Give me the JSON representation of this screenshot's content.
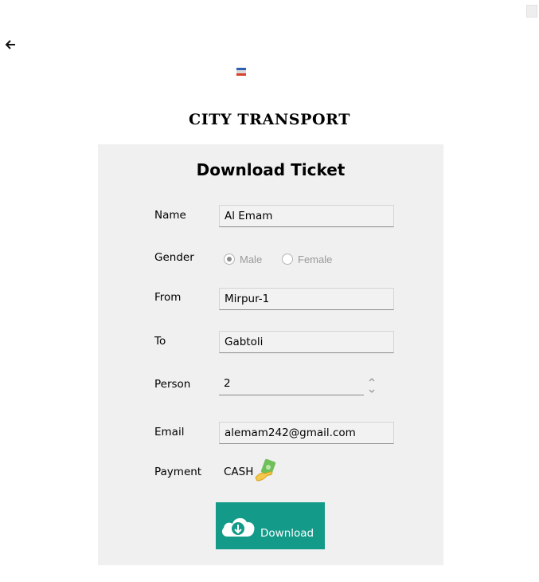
{
  "header": {
    "back_icon": "back-arrow-icon",
    "flag_icon": "flag-icon",
    "app_title": "CITY TRANSPORT"
  },
  "form": {
    "title": "Download Ticket",
    "name_label": "Name",
    "name_value": "Al Emam",
    "gender_label": "Gender",
    "gender_options": [
      "Male",
      "Female"
    ],
    "gender_selected": "Male",
    "from_label": "From",
    "from_value": "Mirpur-1",
    "to_label": "To",
    "to_value": "Gabtoli",
    "person_label": "Person",
    "person_value": "2",
    "email_label": "Email",
    "email_value": "alemam242@gmail.com",
    "payment_label": "Payment",
    "payment_value": "CASH",
    "payment_icon": "cash-icon",
    "download_label": "Download",
    "download_icon": "cloud-download-icon"
  },
  "colors": {
    "card_bg": "#f0f0f0",
    "button_bg": "#139a89",
    "button_text": "#ffffff"
  }
}
